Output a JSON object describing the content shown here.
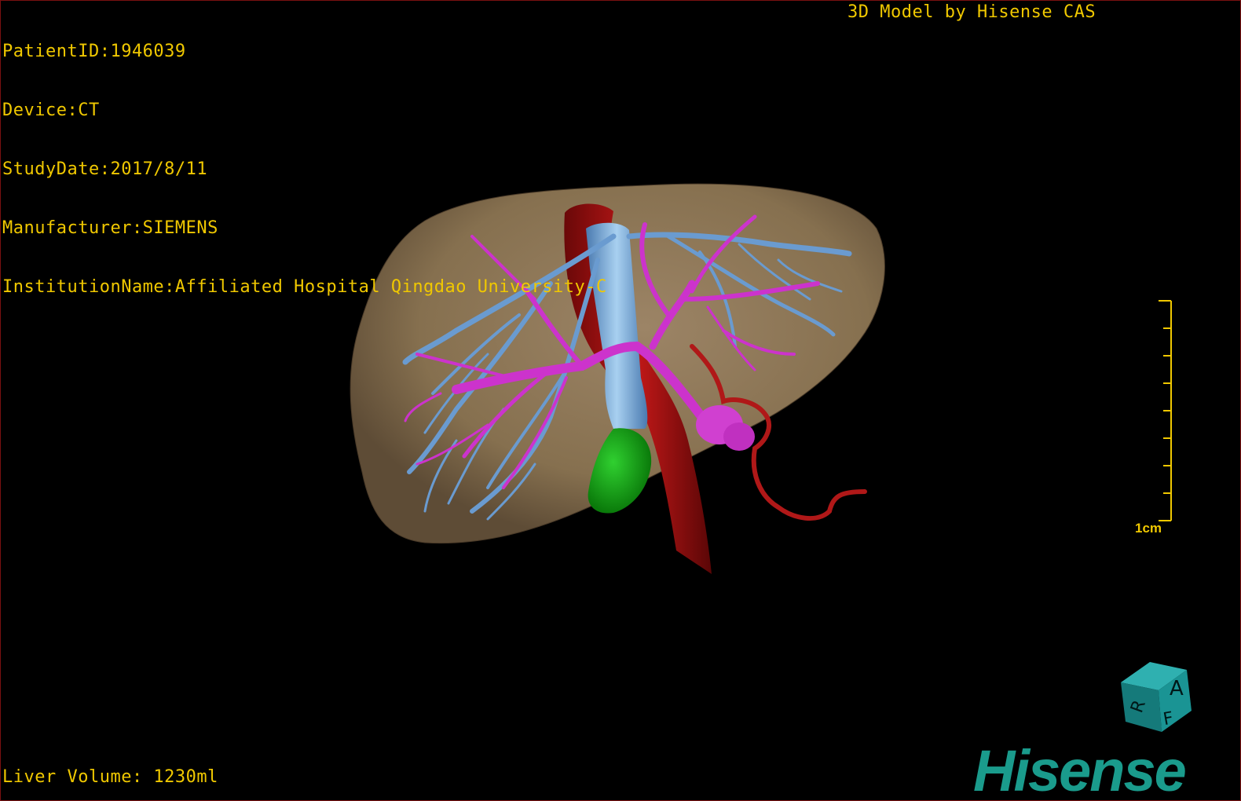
{
  "header": {
    "patient_id": "PatientID:1946039",
    "device": "Device:CT",
    "study_date": "StudyDate:2017/8/11",
    "manufacturer": "Manufacturer:SIEMENS",
    "institution": "InstitutionName:Affiliated Hospital Qingdao University-C",
    "credit": "3D Model by Hisense CAS"
  },
  "footer": {
    "liver_volume": "Liver Volume: 1230ml"
  },
  "scale_bar": {
    "label": "1cm",
    "color": "#f0c800"
  },
  "orientation_cube": {
    "labels": [
      "A",
      "F",
      "R"
    ],
    "color": "#1a8a8a"
  },
  "brand": {
    "name": "Hisense",
    "color": "#1a9b8c"
  },
  "colors": {
    "text": "#f0c800",
    "liver": "#8b7355",
    "portal_vein": "#cc33cc",
    "hepatic_vein": "#6699cc",
    "artery": "#aa1010",
    "gallbladder": "#1fa01f",
    "background": "#000000"
  }
}
